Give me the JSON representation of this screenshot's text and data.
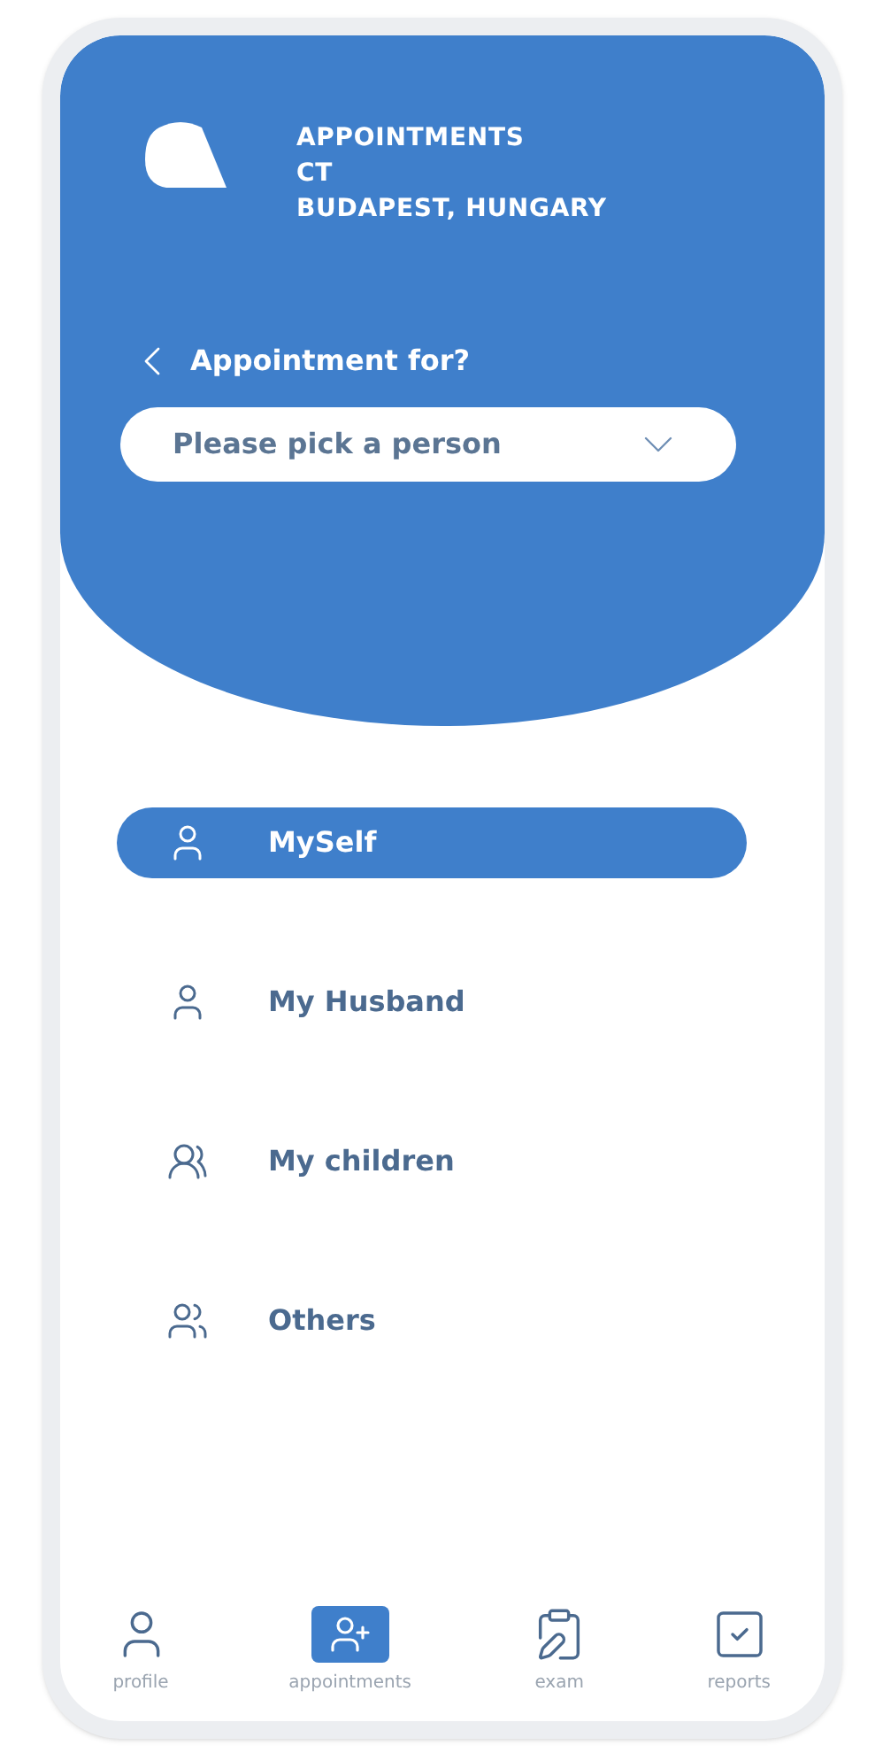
{
  "header": {
    "lines": [
      "APPOINTMENTS",
      "CT",
      "BUDAPEST, HUNGARY"
    ]
  },
  "question": "Appointment for?",
  "picker": {
    "placeholder": "Please pick a person"
  },
  "options": [
    {
      "label": "MySelf",
      "kind": "single",
      "selected": true
    },
    {
      "label": "My Husband",
      "kind": "single",
      "selected": false
    },
    {
      "label": "My children",
      "kind": "group",
      "selected": false
    },
    {
      "label": "Others",
      "kind": "pair",
      "selected": false
    }
  ],
  "nav": [
    {
      "label": "profile",
      "kind": "profile",
      "selected": false
    },
    {
      "label": "appointments",
      "kind": "appointments",
      "selected": true
    },
    {
      "label": "exam",
      "kind": "exam",
      "selected": false
    },
    {
      "label": "reports",
      "kind": "reports",
      "selected": false
    }
  ]
}
